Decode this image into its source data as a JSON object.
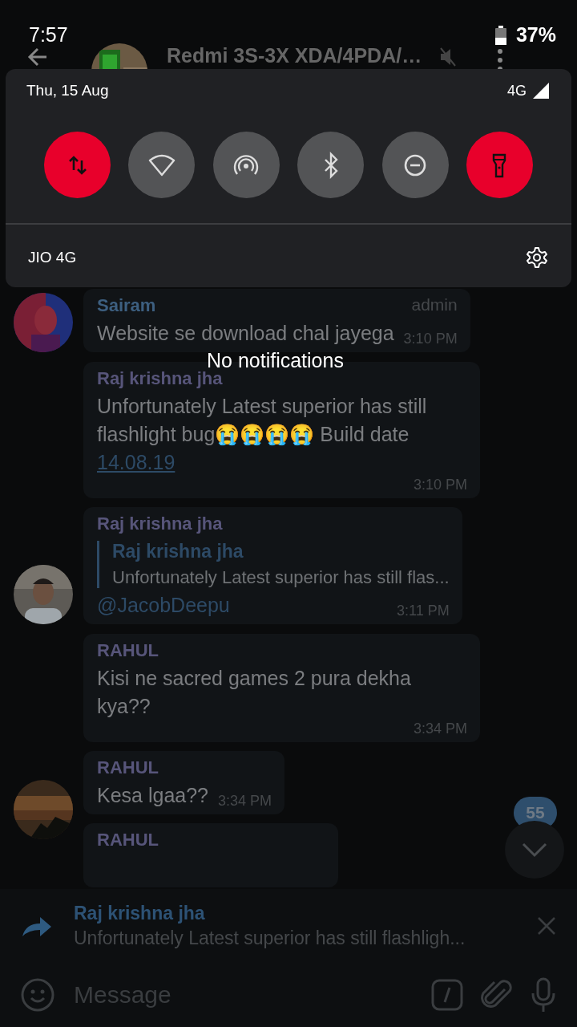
{
  "status_bar": {
    "time": "7:57",
    "battery": "37%"
  },
  "chat_header": {
    "title": "Redmi 3S-3X XDA/4PDA/…"
  },
  "quick_settings": {
    "date": "Thu, 15 Aug",
    "network_type": "4G",
    "toggles": [
      {
        "kind": "mobile-data",
        "on": true
      },
      {
        "kind": "wifi",
        "on": false
      },
      {
        "kind": "hotspot",
        "on": false
      },
      {
        "kind": "bluetooth",
        "on": false
      },
      {
        "kind": "dnd",
        "on": false
      },
      {
        "kind": "flashlight",
        "on": true
      }
    ],
    "carrier": "JIO 4G"
  },
  "notice": "No notifications",
  "groups": [
    {
      "messages": [
        {
          "sender": "Sairam",
          "color": "#3d5f80",
          "badge": "admin",
          "text": "Website se download chal jayega",
          "time": "3:10 PM"
        }
      ]
    },
    {
      "messages": [
        {
          "sender": "Raj krishna jha",
          "color": "#57557a",
          "text": "Unfortunately Latest superior has still flashlight bug😭😭😭😭 Build date",
          "link": "14.08.19",
          "time": "3:10 PM"
        },
        {
          "sender": "Raj krishna jha",
          "color": "#57557a",
          "quote": {
            "name": "Raj krishna jha",
            "text": "Unfortunately Latest superior has still flas..."
          },
          "mention": "@JacobDeepu",
          "time": "3:11 PM"
        }
      ]
    },
    {
      "messages": [
        {
          "sender": "RAHUL",
          "color": "#57557a",
          "text": "Kisi ne sacred games 2 pura dekha kya??",
          "time": "3:34 PM"
        },
        {
          "sender": "RAHUL",
          "color": "#57557a",
          "text": "Kesa lgaa??",
          "time": "3:34 PM"
        },
        {
          "sender": "RAHUL",
          "color": "#57557a"
        }
      ]
    }
  ],
  "scroll": {
    "unread": "55"
  },
  "reply": {
    "name": "Raj krishna jha",
    "text": "Unfortunately Latest superior has still flashligh..."
  },
  "composer": {
    "placeholder": "Message"
  }
}
